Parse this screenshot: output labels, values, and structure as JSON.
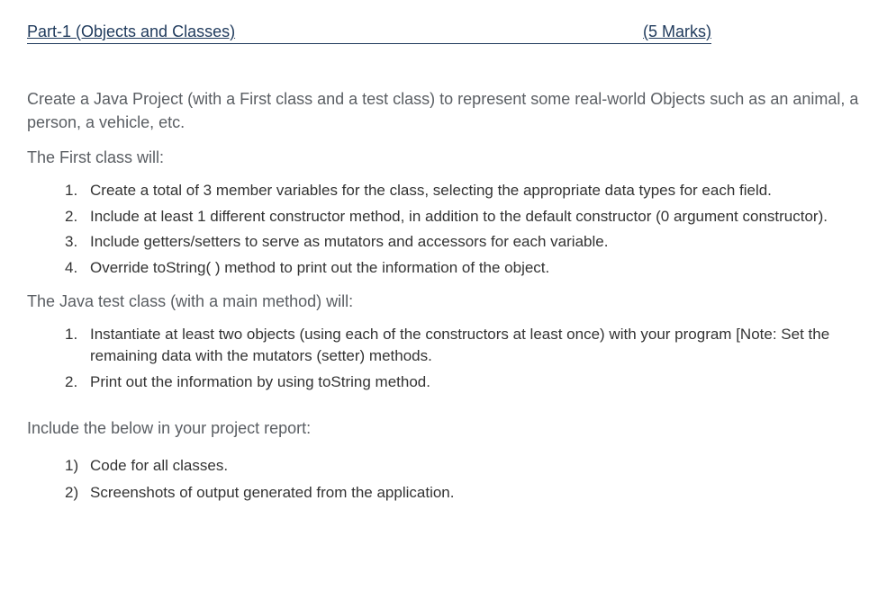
{
  "header": {
    "title": "Part-1 (Objects and Classes)",
    "marks": "(5 Marks)"
  },
  "intro": "Create a Java Project (with a First class and a test class) to represent some real-world Objects such as an animal, a person, a vehicle, etc.",
  "first_class_head": "The First class will:",
  "first_class_items": [
    "Create a total of 3 member variables for the class, selecting the appropriate data types for each field.",
    "Include at least 1 different constructor method, in addition to the default constructor (0 argument constructor).",
    "Include getters/setters to serve as mutators and accessors for each variable.",
    "Override toString( ) method to print out the information of the object."
  ],
  "test_class_head": "The Java test class (with a main method) will:",
  "test_class_items": [
    "Instantiate at least two objects (using each of the constructors at least once) with your program [Note: Set the remaining data with the mutators (setter) methods.",
    "Print out the information by using toString method."
  ],
  "report_head": "Include the below in your project report:",
  "report_items": [
    "Code for all classes.",
    "Screenshots of output generated from the application."
  ]
}
